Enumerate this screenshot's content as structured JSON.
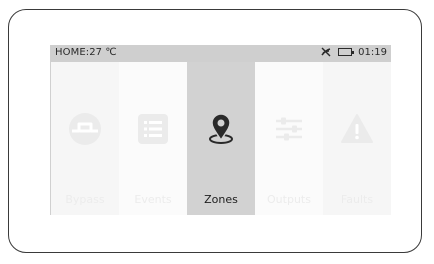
{
  "status": {
    "location": "HOME:",
    "temperature": "27 ℃",
    "time": "01:19",
    "signal_icon": "no-signal-icon",
    "battery_icon": "battery-icon"
  },
  "tiles": [
    {
      "label": "Bypass",
      "icon": "bypass-icon",
      "active": false
    },
    {
      "label": "Events",
      "icon": "events-list-icon",
      "active": false
    },
    {
      "label": "Zones",
      "icon": "location-pin-icon",
      "active": true
    },
    {
      "label": "Outputs",
      "icon": "sliders-icon",
      "active": false
    },
    {
      "label": "Faults",
      "icon": "warning-icon",
      "active": false
    }
  ],
  "colors": {
    "status_bar": "#cfcfcf",
    "active_tile": "#d2d2d2",
    "inactive_tile": "#f6f6f6",
    "faded_icon": "#ebebeb",
    "active_icon": "#2a2a2a"
  }
}
